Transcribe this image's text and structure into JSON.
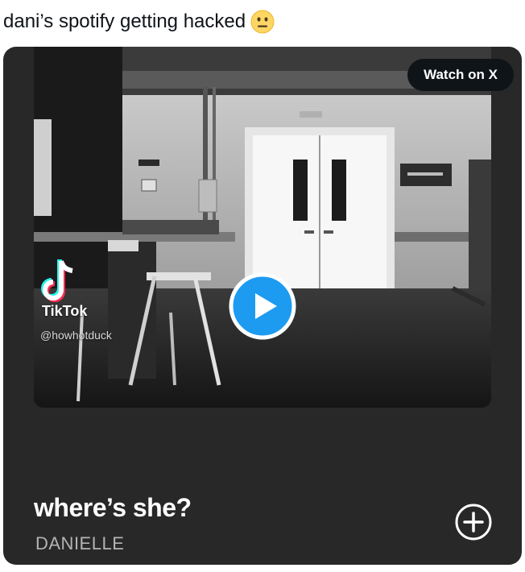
{
  "tweet": {
    "text": "dani’s spotify getting hacked",
    "emoji": "neutral-face-emoji"
  },
  "media": {
    "watch_label": "Watch on X",
    "play_icon": "play-icon",
    "tiktok": {
      "name": "TikTok",
      "handle": "@howhotduck"
    },
    "song": {
      "title": "where’s she?",
      "artist": "DANIELLE"
    },
    "add_icon": "plus-circle-icon"
  },
  "colors": {
    "card_bg": "#282828",
    "play_blue": "#1d9bf0",
    "watch_bg": "#0f1419"
  }
}
